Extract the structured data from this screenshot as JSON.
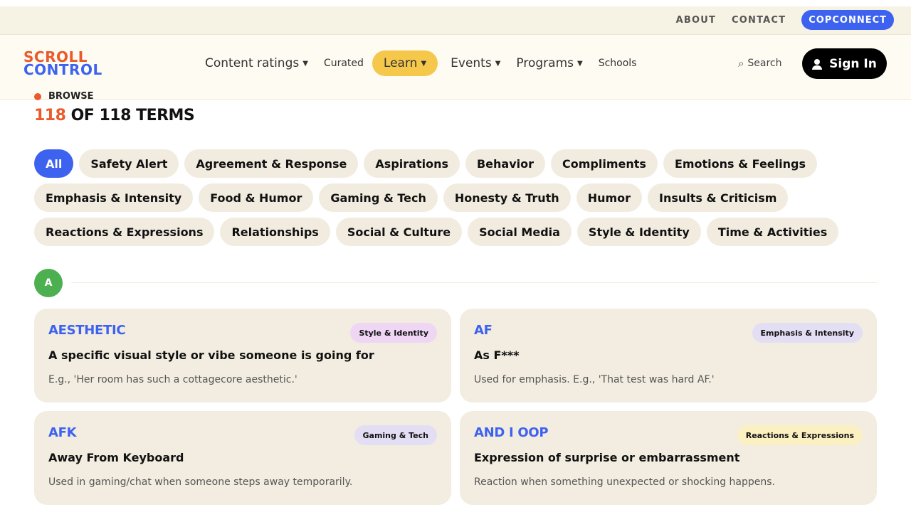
{
  "topbar": {
    "about": "ABOUT",
    "contact": "CONTACT",
    "copconnect": "COPCONNECT"
  },
  "logo": {
    "line1": "SCROLL",
    "line2": "CONTROL"
  },
  "nav": {
    "content_ratings": "Content ratings",
    "curated": "Curated",
    "learn": "Learn",
    "events": "Events",
    "programs": "Programs",
    "schools": "Schools",
    "search": "Search",
    "sign_in": "Sign In"
  },
  "browse": {
    "label": "BROWSE",
    "count_shown": "118",
    "count_rest": " OF 118 TERMS"
  },
  "filters": {
    "row1": [
      "All",
      "Safety Alert",
      "Agreement & Response",
      "Aspirations",
      "Behavior",
      "Compliments",
      "Emotions & Feelings"
    ],
    "row2": [
      "Emphasis & Intensity",
      "Food & Humor",
      "Gaming & Tech",
      "Honesty & Truth",
      "Humor",
      "Insults & Criticism"
    ],
    "row3": [
      "Reactions & Expressions",
      "Relationships",
      "Social & Culture",
      "Social Media",
      "Style & Identity",
      "Time & Activities"
    ]
  },
  "section_letter": "A",
  "cards": [
    {
      "term": "AESTHETIC",
      "tag": "Style & Identity",
      "tag_color": "#efd6f5",
      "definition": "A specific visual style or vibe someone is going for",
      "example": "E.g., 'Her room has such a cottagecore aesthetic.'"
    },
    {
      "term": "AF",
      "tag": "Emphasis & Intensity",
      "tag_color": "#e4def5",
      "definition": "As F***",
      "example": "Used for emphasis. E.g., 'That test was hard AF.'"
    },
    {
      "term": "AFK",
      "tag": "Gaming & Tech",
      "tag_color": "#e4def5",
      "definition": "Away From Keyboard",
      "example": "Used in gaming/chat when someone steps away temporarily."
    },
    {
      "term": "AND I OOP",
      "tag": "Reactions & Expressions",
      "tag_color": "#fbf0c2",
      "definition": "Expression of surprise or embarrassment",
      "example": "Reaction when something unexpected or shocking happens."
    }
  ],
  "colors": {
    "accent_blue": "#3d62f0",
    "accent_orange": "#ea5a2b",
    "learn_yellow": "#f5c84c",
    "letter_green": "#4caf50"
  }
}
